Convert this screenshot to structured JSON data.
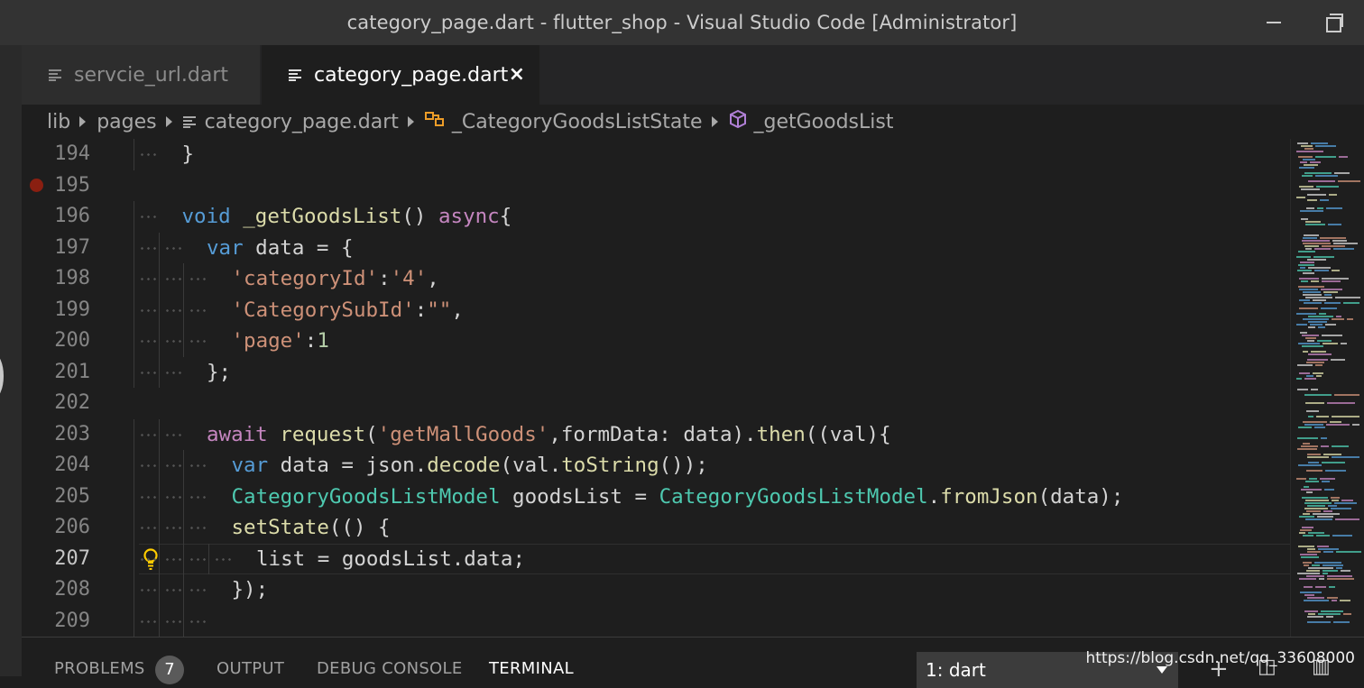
{
  "window": {
    "title": "category_page.dart - flutter_shop - Visual Studio Code [Administrator]"
  },
  "tabs": [
    {
      "label": "servcie_url.dart",
      "active": false
    },
    {
      "label": "category_page.dart",
      "active": true,
      "close": "×"
    }
  ],
  "breadcrumb": [
    "lib",
    "pages",
    "category_page.dart",
    "_CategoryGoodsListState",
    "_getGoodsList"
  ],
  "editor": {
    "current_line": 207,
    "breakpoint_line": 195,
    "lines": [
      {
        "n": "194",
        "tokens": [
          {
            "t": "}",
            "c": "var"
          }
        ]
      },
      {
        "n": "195",
        "tokens": []
      },
      {
        "n": "196",
        "tokens": [
          {
            "t": "void",
            "c": "kw"
          },
          {
            "t": " ",
            "c": "var"
          },
          {
            "t": "_getGoodsList",
            "c": "fn"
          },
          {
            "t": "() ",
            "c": "var"
          },
          {
            "t": "async",
            "c": "kw2"
          },
          {
            "t": "{",
            "c": "var"
          }
        ]
      },
      {
        "n": "197",
        "tokens": [
          {
            "t": "var",
            "c": "kw"
          },
          {
            "t": " data = {",
            "c": "var"
          }
        ]
      },
      {
        "n": "198",
        "tokens": [
          {
            "t": "'categoryId'",
            "c": "str"
          },
          {
            "t": ":",
            "c": "var"
          },
          {
            "t": "'4'",
            "c": "str"
          },
          {
            "t": ",",
            "c": "var"
          }
        ]
      },
      {
        "n": "199",
        "tokens": [
          {
            "t": "'CategorySubId'",
            "c": "str"
          },
          {
            "t": ":",
            "c": "var"
          },
          {
            "t": "\"\"",
            "c": "str"
          },
          {
            "t": ",",
            "c": "var"
          }
        ]
      },
      {
        "n": "200",
        "tokens": [
          {
            "t": "'page'",
            "c": "str"
          },
          {
            "t": ":",
            "c": "var"
          },
          {
            "t": "1",
            "c": "num"
          }
        ]
      },
      {
        "n": "201",
        "tokens": [
          {
            "t": "};",
            "c": "var"
          }
        ]
      },
      {
        "n": "202",
        "tokens": []
      },
      {
        "n": "203",
        "tokens": [
          {
            "t": "await",
            "c": "kw2"
          },
          {
            "t": " ",
            "c": "var"
          },
          {
            "t": "request",
            "c": "fn"
          },
          {
            "t": "(",
            "c": "var"
          },
          {
            "t": "'getMallGoods'",
            "c": "str"
          },
          {
            "t": ",formData: data).",
            "c": "var"
          },
          {
            "t": "then",
            "c": "fn"
          },
          {
            "t": "((val){",
            "c": "var"
          }
        ]
      },
      {
        "n": "204",
        "tokens": [
          {
            "t": "var",
            "c": "kw"
          },
          {
            "t": " data = json.",
            "c": "var"
          },
          {
            "t": "decode",
            "c": "fn"
          },
          {
            "t": "(val.",
            "c": "var"
          },
          {
            "t": "toString",
            "c": "fn"
          },
          {
            "t": "());",
            "c": "var"
          }
        ]
      },
      {
        "n": "205",
        "tokens": [
          {
            "t": "CategoryGoodsListModel",
            "c": "type"
          },
          {
            "t": " goodsList = ",
            "c": "var"
          },
          {
            "t": "CategoryGoodsListModel",
            "c": "type"
          },
          {
            "t": ".",
            "c": "var"
          },
          {
            "t": "fromJson",
            "c": "fn"
          },
          {
            "t": "(data);",
            "c": "var"
          }
        ]
      },
      {
        "n": "206",
        "tokens": [
          {
            "t": "setState",
            "c": "fn"
          },
          {
            "t": "(() {",
            "c": "var"
          }
        ]
      },
      {
        "n": "207",
        "tokens": [
          {
            "t": "list = goodsList.data;",
            "c": "var"
          }
        ]
      },
      {
        "n": "208",
        "tokens": [
          {
            "t": "});",
            "c": "var"
          }
        ]
      },
      {
        "n": "209",
        "tokens": []
      }
    ]
  },
  "panel": {
    "tabs": [
      {
        "label": "PROBLEMS",
        "active": false
      },
      {
        "label": "OUTPUT",
        "active": false
      },
      {
        "label": "DEBUG CONSOLE",
        "active": false
      },
      {
        "label": "TERMINAL",
        "active": true
      }
    ],
    "problems_count": "7",
    "terminal_select": "1: dart"
  },
  "watermark": "https://blog.csdn.net/qq_33608000",
  "icons": {
    "file": "file-lines-icon",
    "class": "class-symbol-icon",
    "method": "method-cube-icon",
    "lightbulb": "lightbulb-icon",
    "add": "plus-icon",
    "split": "split-icon",
    "trash": "trash-icon"
  },
  "colors": {
    "keyword": "#569cd6",
    "control": "#c586c0",
    "function": "#dcdcaa",
    "string": "#ce9178",
    "number": "#b5cea8",
    "type": "#4ec9b0",
    "breakpoint": "#8a1f11"
  }
}
